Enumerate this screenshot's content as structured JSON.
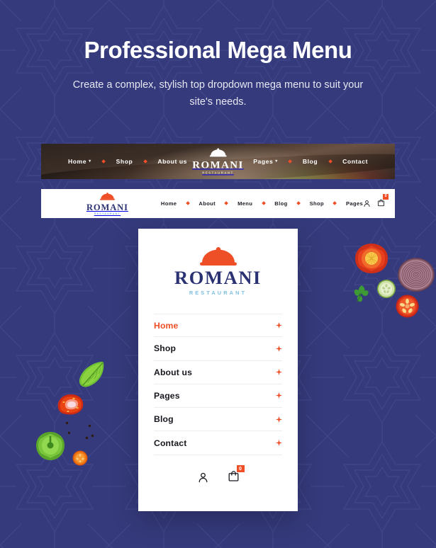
{
  "theme": {
    "background": "#353a7c",
    "accent": "#ee4f27",
    "navy": "#2b3272",
    "panel_bg": "#ffffff",
    "light_blue": "#7fc0e0"
  },
  "hero": {
    "title": "Professional Mega Menu",
    "subtitle": "Create a complex, stylish top dropdown mega menu to suit your site's needs."
  },
  "navbar_dark": {
    "left_items": [
      {
        "label": "Home",
        "caret": "▾"
      },
      {
        "label": "Shop",
        "caret": ""
      },
      {
        "label": "About us",
        "caret": ""
      }
    ],
    "right_items": [
      {
        "label": "Pages",
        "caret": "▾"
      },
      {
        "label": "Blog",
        "caret": ""
      },
      {
        "label": "Contact",
        "caret": ""
      }
    ],
    "logo": {
      "word": "ROMANI",
      "sub": "RESTAURANT",
      "icon": "cloche-icon"
    }
  },
  "navbar_light": {
    "logo": {
      "word": "ROMANI",
      "sub": "RESTAURANT",
      "icon": "cloche-icon"
    },
    "items": [
      {
        "label": "Home"
      },
      {
        "label": "About"
      },
      {
        "label": "Menu"
      },
      {
        "label": "Blog"
      },
      {
        "label": "Shop"
      },
      {
        "label": "Pages"
      }
    ],
    "icons": {
      "account": "user-icon",
      "cart": "shopping-bag-icon",
      "cart_count": "0"
    }
  },
  "dropdown_panel": {
    "logo": {
      "word": "ROMANI",
      "sub": "RESTAURANT",
      "icon": "cloche-icon"
    },
    "menu_items": [
      {
        "label": "Home",
        "active": true,
        "marker": "four-point-star-icon"
      },
      {
        "label": "Shop",
        "active": false,
        "marker": "four-point-star-icon"
      },
      {
        "label": "About us",
        "active": false,
        "marker": "four-point-star-icon"
      },
      {
        "label": "Pages",
        "active": false,
        "marker": "four-point-star-icon"
      },
      {
        "label": "Blog",
        "active": false,
        "marker": "four-point-star-icon"
      },
      {
        "label": "Contact",
        "active": false,
        "marker": "four-point-star-icon"
      }
    ],
    "icons": {
      "account": "user-icon",
      "cart": "shopping-bag-icon",
      "cart_count": "0"
    }
  },
  "decorations": [
    {
      "name": "red-bell-pepper"
    },
    {
      "name": "red-onion-slice"
    },
    {
      "name": "cucumber-slice"
    },
    {
      "name": "parsley-leaf"
    },
    {
      "name": "tomato-slice"
    },
    {
      "name": "basil-leaf"
    },
    {
      "name": "tomato-wedge"
    },
    {
      "name": "green-bell-pepper"
    },
    {
      "name": "carrot-slice"
    },
    {
      "name": "peppercorn"
    }
  ]
}
